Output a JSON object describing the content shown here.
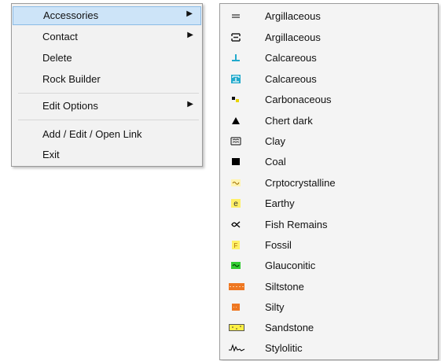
{
  "main_menu": {
    "items": [
      {
        "label": "Accessories",
        "arrow": "▶"
      },
      {
        "label": "Contact",
        "arrow": "▶"
      },
      {
        "label": "Delete"
      },
      {
        "label": "Rock Builder"
      },
      {
        "label": "Edit Options",
        "arrow": "▶"
      },
      {
        "label": "Add / Edit / Open Link"
      },
      {
        "label": "Exit"
      }
    ],
    "highlighted": "Accessories"
  },
  "accessories_submenu": {
    "items": [
      {
        "label": "Argillaceous",
        "icon": "argillaceous-dash-icon",
        "color": "#7a7a7a"
      },
      {
        "label": "Argillaceous",
        "icon": "argillaceous-bracket-icon",
        "color": "#222222"
      },
      {
        "label": "Calcareous",
        "icon": "calcareous-t-icon",
        "color": "#22aacc"
      },
      {
        "label": "Calcareous",
        "icon": "calcareous-box-icon",
        "color": "#22aacc"
      },
      {
        "label": "Carbonaceous",
        "icon": "carbonaceous-dots-icon",
        "color": "#111111"
      },
      {
        "label": "Chert dark",
        "icon": "triangle-icon",
        "color": "#000000"
      },
      {
        "label": "Clay",
        "icon": "clay-icon",
        "color": "#333333"
      },
      {
        "label": "Coal",
        "icon": "coal-square-icon",
        "color": "#000000"
      },
      {
        "label": "Crptocrystalline",
        "icon": "crypto-icon",
        "color": "#ffee88"
      },
      {
        "label": "Earthy",
        "icon": "earthy-e-icon",
        "color": "#ffee55"
      },
      {
        "label": "Fish Remains",
        "icon": "fish-icon",
        "color": "#000000"
      },
      {
        "label": "Fossil",
        "icon": "fossil-icon",
        "color": "#ffee55"
      },
      {
        "label": "Glauconitic",
        "icon": "glauconitic-icon",
        "color": "#33cc33"
      },
      {
        "label": "Siltstone",
        "icon": "siltstone-icon",
        "color": "#ee7722"
      },
      {
        "label": "Silty",
        "icon": "silty-icon",
        "color": "#ee7722"
      },
      {
        "label": "Sandstone",
        "icon": "sandstone-icon",
        "color": "#ffee44"
      },
      {
        "label": "Stylolitic",
        "icon": "stylolitic-icon",
        "color": "#000000"
      }
    ]
  }
}
